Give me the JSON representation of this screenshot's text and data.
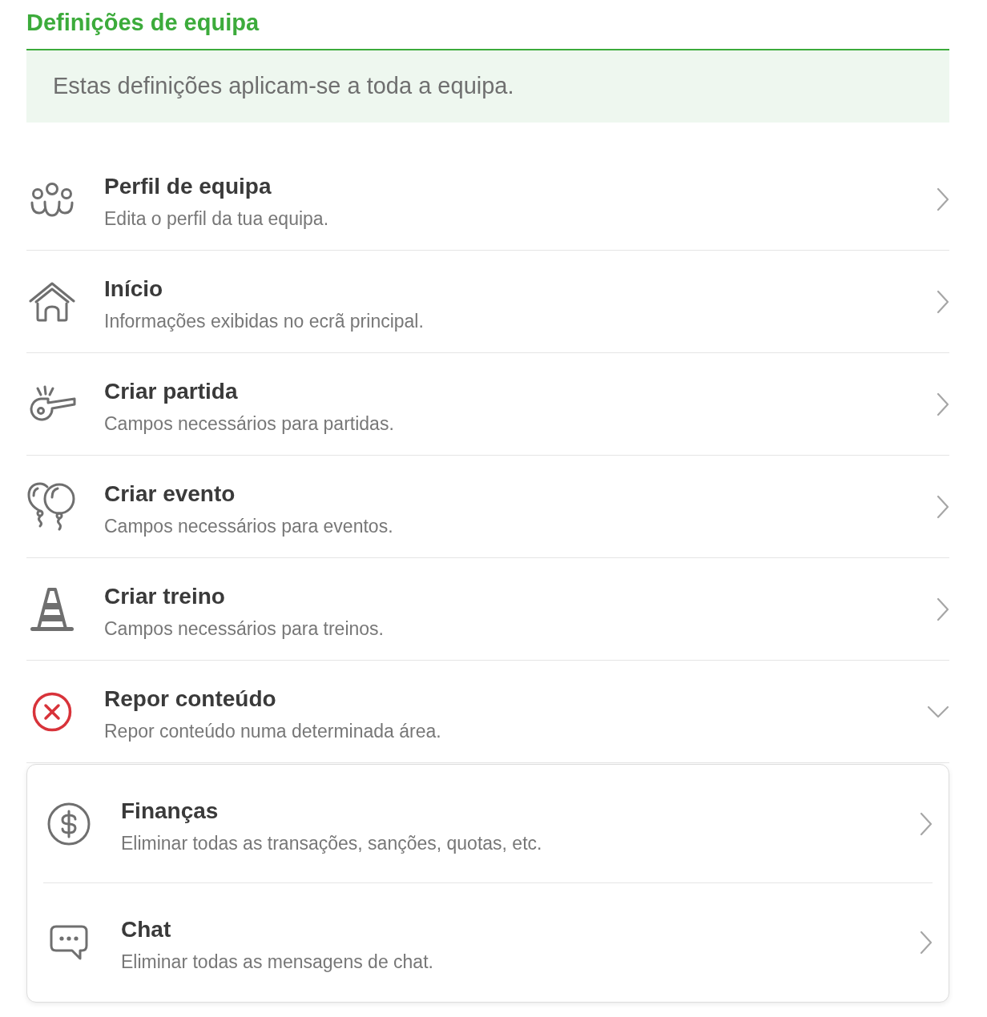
{
  "header": {
    "title": "Definições de equipa"
  },
  "notice": {
    "text": "Estas definições aplicam-se a toda a equipa."
  },
  "settings": [
    {
      "kind": "link",
      "title": "Perfil de equipa",
      "subtitle": "Edita o perfil da tua equipa."
    },
    {
      "kind": "link",
      "title": "Início",
      "subtitle": "Informações exibidas no ecrã principal."
    },
    {
      "kind": "link",
      "title": "Criar partida",
      "subtitle": "Campos necessários para partidas."
    },
    {
      "kind": "link",
      "title": "Criar evento",
      "subtitle": "Campos necessários para eventos."
    },
    {
      "kind": "link",
      "title": "Criar treino",
      "subtitle": "Campos necessários para treinos."
    },
    {
      "kind": "expandable",
      "title": "Repor conteúdo",
      "subtitle": "Repor conteúdo numa determinada área.",
      "expanded": true,
      "children": [
        {
          "title": "Finanças",
          "subtitle": "Eliminar todas as transações, sanções, quotas, etc."
        },
        {
          "title": "Chat",
          "subtitle": "Eliminar todas as mensagens de chat."
        }
      ]
    }
  ]
}
